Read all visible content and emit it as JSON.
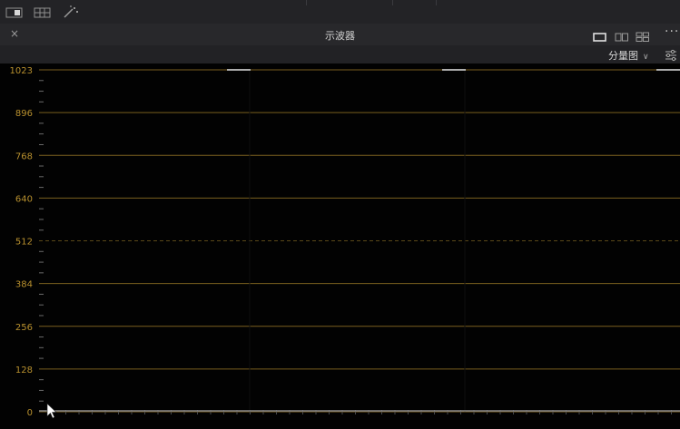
{
  "toolbar": {
    "icons": [
      "viewer-layout-icon",
      "grid-layout-icon",
      "magic-wand-icon"
    ]
  },
  "panel": {
    "title": "示波器",
    "close_icon": "×",
    "more_icon": "···",
    "display_mode": "分量图",
    "layout_icons": [
      "single-view-icon",
      "dual-view-icon",
      "quad-view-icon"
    ]
  },
  "scope": {
    "mode": "parade",
    "y_axis_labels": [
      "1023",
      "896",
      "768",
      "640",
      "512",
      "384",
      "256",
      "128",
      "0"
    ],
    "colors": {
      "background": "#020202",
      "grid": "#7a5f1f",
      "label": "#b8902e",
      "midline": "#5a4818"
    }
  }
}
